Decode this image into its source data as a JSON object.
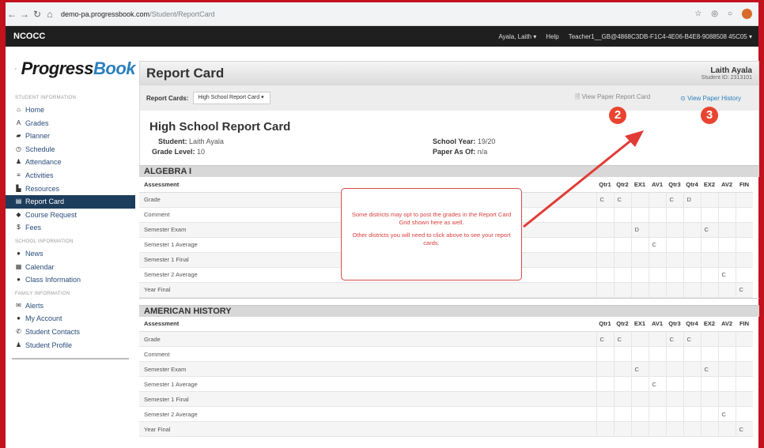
{
  "browser": {
    "host": "demo-pa.progressbook.com",
    "path": "/Student/ReportCard"
  },
  "topbar": {
    "brand": "NCOCC",
    "user_menu": "Ayala, Laith ▾",
    "help": "Help",
    "teacher": "Teacher1__GB@4868C3DB-F1C4-4E06-B4E8-9088508 45C05 ▾"
  },
  "logo": {
    "progress": "Progress",
    "book": "Book"
  },
  "sidebar": {
    "student_info_head": "STUDENT INFORMATION",
    "student_items": [
      {
        "label": "Home",
        "icon": "home-icon",
        "glyph": "⌂"
      },
      {
        "label": "Grades",
        "icon": "grades-icon",
        "glyph": "A"
      },
      {
        "label": "Planner",
        "icon": "planner-icon",
        "glyph": "▰"
      },
      {
        "label": "Schedule",
        "icon": "clock-icon",
        "glyph": "◷"
      },
      {
        "label": "Attendance",
        "icon": "attendance-icon",
        "glyph": "♟"
      },
      {
        "label": "Activities",
        "icon": "list-icon",
        "glyph": "≡"
      },
      {
        "label": "Resources",
        "icon": "file-icon",
        "glyph": "▙"
      },
      {
        "label": "Report Card",
        "icon": "report-card-icon",
        "glyph": "▤"
      },
      {
        "label": "Course Request",
        "icon": "tag-icon",
        "glyph": "◆"
      },
      {
        "label": "Fees",
        "icon": "dollar-icon",
        "glyph": "$"
      }
    ],
    "school_info_head": "SCHOOL INFORMATION",
    "school_items": [
      {
        "label": "News",
        "icon": "news-icon",
        "glyph": "●"
      },
      {
        "label": "Calendar",
        "icon": "calendar-icon",
        "glyph": "▦"
      },
      {
        "label": "Class Information",
        "icon": "chat-icon",
        "glyph": "●"
      }
    ],
    "family_info_head": "FAMILY INFORMATION",
    "family_items": [
      {
        "label": "Alerts",
        "icon": "mail-icon",
        "glyph": "✉"
      },
      {
        "label": "My Account",
        "icon": "info-icon",
        "glyph": "●"
      },
      {
        "label": "Student Contacts",
        "icon": "phone-icon",
        "glyph": "✆"
      },
      {
        "label": "Student Profile",
        "icon": "user-icon",
        "glyph": "♟"
      }
    ]
  },
  "header": {
    "title": "Report Card",
    "student_name": "Laith Ayala",
    "student_id": "Student ID: 2313101"
  },
  "rc_bar": {
    "label": "Report Cards:",
    "selected": "High School Report Card  ▾",
    "view_paper": "View Paper Report Card",
    "view_history": "View Paper History"
  },
  "card": {
    "title": "High School Report Card",
    "student_label": "Student:",
    "student_value": "Laith Ayala",
    "grade_label": "Grade Level:",
    "grade_value": "10",
    "year_label": "School Year:",
    "year_value": "19/20",
    "paper_label": "Paper As Of:",
    "paper_value": "n/a"
  },
  "columns": [
    "Assessment",
    "Qtr1",
    "Qtr2",
    "EX1",
    "AV1",
    "Qtr3",
    "Qtr4",
    "EX2",
    "AV2",
    "FIN"
  ],
  "courses": [
    {
      "name": "ALGEBRA I",
      "rows": [
        {
          "label": "Grade",
          "cells": [
            "C",
            "C",
            "",
            "",
            "C",
            "D",
            "",
            "",
            ""
          ]
        },
        {
          "label": "Comment",
          "cells": [
            "",
            "",
            "",
            "",
            "",
            "",
            "",
            "",
            ""
          ]
        },
        {
          "label": "Semester Exam",
          "cells": [
            "",
            "",
            "D",
            "",
            "",
            "",
            "C",
            "",
            ""
          ]
        },
        {
          "label": "Semester 1 Average",
          "cells": [
            "",
            "",
            "",
            "C",
            "",
            "",
            "",
            "",
            ""
          ]
        },
        {
          "label": "Semester 1 Final",
          "cells": [
            "",
            "",
            "",
            "",
            "",
            "",
            "",
            "",
            ""
          ]
        },
        {
          "label": "Semester 2 Average",
          "cells": [
            "",
            "",
            "",
            "",
            "",
            "",
            "",
            "C",
            ""
          ]
        },
        {
          "label": "Year Final",
          "cells": [
            "",
            "",
            "",
            "",
            "",
            "",
            "",
            "",
            "C"
          ]
        }
      ]
    },
    {
      "name": "AMERICAN HISTORY",
      "rows": [
        {
          "label": "Grade",
          "cells": [
            "C",
            "C",
            "",
            "",
            "C",
            "C",
            "",
            "",
            ""
          ]
        },
        {
          "label": "Comment",
          "cells": [
            "",
            "",
            "",
            "",
            "",
            "",
            "",
            "",
            ""
          ]
        },
        {
          "label": "Semester Exam",
          "cells": [
            "",
            "",
            "C",
            "",
            "",
            "",
            "C",
            "",
            ""
          ]
        },
        {
          "label": "Semester 1 Average",
          "cells": [
            "",
            "",
            "",
            "C",
            "",
            "",
            "",
            "",
            ""
          ]
        },
        {
          "label": "Semester 1 Final",
          "cells": [
            "",
            "",
            "",
            "",
            "",
            "",
            "",
            "",
            ""
          ]
        },
        {
          "label": "Semester 2 Average",
          "cells": [
            "",
            "",
            "",
            "",
            "",
            "",
            "",
            "C",
            ""
          ]
        },
        {
          "label": "Year Final",
          "cells": [
            "",
            "",
            "",
            "",
            "",
            "",
            "",
            "",
            "C"
          ]
        }
      ]
    }
  ],
  "annotation": {
    "callout_line1": "Some districts may opt to post the grades in the Report Card Grid shown here as well.",
    "callout_line2": "Other districts you will need to click above to see your report cards.",
    "badge2": "2",
    "badge3": "3",
    "arrow_color": "#e23b35"
  }
}
